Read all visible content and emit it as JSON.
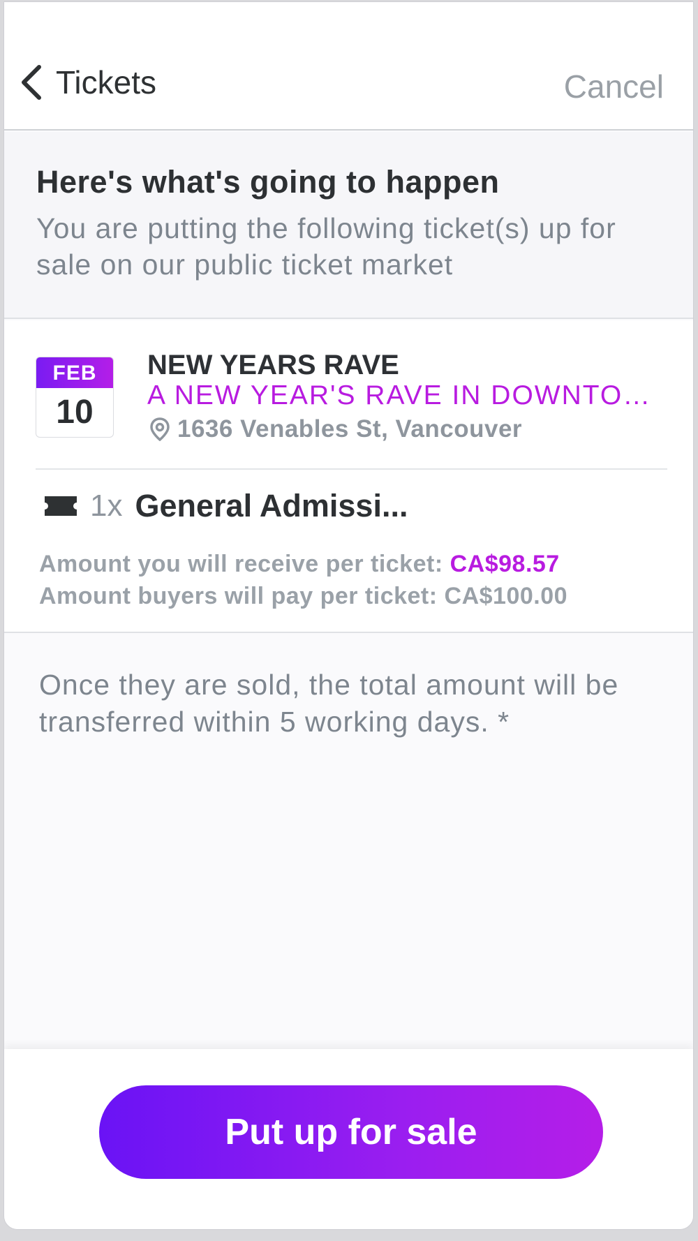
{
  "header": {
    "back_label": "Tickets",
    "cancel_label": "Cancel"
  },
  "intro": {
    "title": "Here's what's going to happen",
    "subtitle": "You are putting the following ticket(s) up for sale on our public ticket market"
  },
  "event": {
    "month": "FEB",
    "day": "10",
    "name": "NEW YEARS RAVE",
    "description": "A NEW YEAR'S RAVE IN DOWNTOWN VANCOUVER",
    "location": "1636 Venables St, Vancouver"
  },
  "ticket": {
    "quantity": "1x",
    "name": "General Admissi...",
    "receive_label": "Amount you will receive per ticket:",
    "receive_value": "CA$98.57",
    "pay_label": "Amount buyers will pay per ticket:",
    "pay_value": "CA$100.00"
  },
  "note": "Once they are sold, the total amount will be transferred within 5 working days. *",
  "footer": {
    "cta_label": "Put up for sale"
  },
  "colors": {
    "accent": "#b81be0",
    "gradient_start": "#6a13f5",
    "gradient_end": "#b51ee8"
  }
}
